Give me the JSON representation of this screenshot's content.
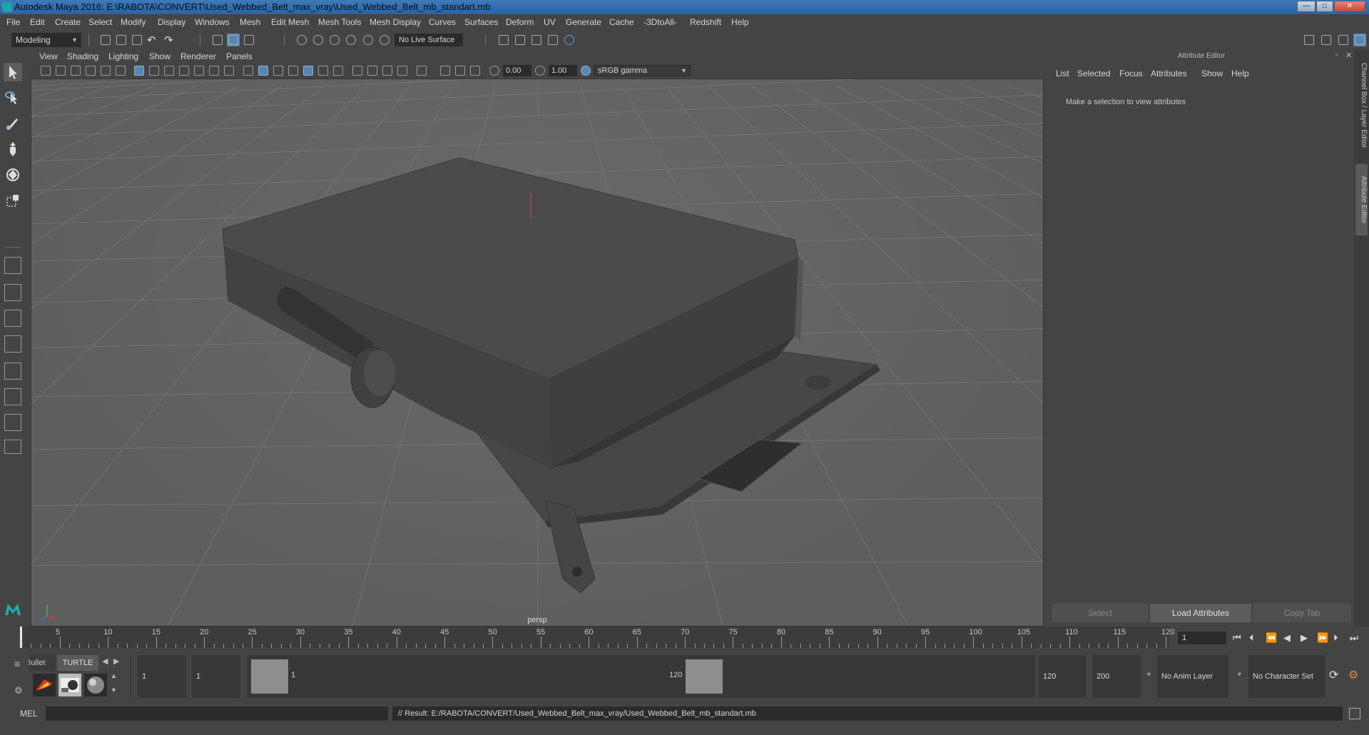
{
  "window": {
    "title": "Autodesk Maya 2016: E:\\RABOTA\\CONVERT\\Used_Webbed_Belt_max_vray\\Used_Webbed_Belt_mb_standart.mb",
    "min_label": "—",
    "max_label": "□",
    "close_label": "✕"
  },
  "menubar": [
    "File",
    "Edit",
    "Create",
    "Select",
    "Modify",
    "Display",
    "Windows",
    "Mesh",
    "Edit Mesh",
    "Mesh Tools",
    "Mesh Display",
    "Curves",
    "Surfaces",
    "Deform",
    "UV",
    "Generate",
    "Cache",
    "-3DtoAll-",
    "Redshift",
    "Help"
  ],
  "statusline": {
    "mode": "Modeling",
    "live_surface": "No Live Surface"
  },
  "viewport": {
    "menu": [
      "View",
      "Shading",
      "Lighting",
      "Show",
      "Renderer",
      "Panels"
    ],
    "exposure": "0.00",
    "gamma": "1.00",
    "color_space": "sRGB gamma",
    "camera": "persp",
    "colors": {
      "background": "#5e5e5e",
      "grid": "#777777",
      "model": "#4a4a4a"
    }
  },
  "attribute_editor": {
    "title": "Attribute Editor",
    "menu": [
      "List",
      "Selected",
      "Focus",
      "Attributes",
      "Show",
      "Help"
    ],
    "message": "Make a selection to view attributes",
    "buttons": {
      "select": "Select",
      "load": "Load Attributes",
      "copy": "Copy Tab"
    },
    "side_tabs": [
      "Channel Box / Layer Editor",
      "Attribute Editor"
    ]
  },
  "timeline": {
    "ticks": [
      "5",
      "10",
      "15",
      "20",
      "25",
      "30",
      "35",
      "40",
      "45",
      "50",
      "55",
      "60",
      "65",
      "70",
      "75",
      "80",
      "85",
      "90",
      "95",
      "100",
      "105",
      "110",
      "115",
      "120"
    ],
    "current_frame": "1",
    "current_frame_field": "1"
  },
  "range": {
    "shelf_tabs": [
      "Bullet",
      "TURTLE"
    ],
    "start": "1",
    "playback_start": "1",
    "range_start_label": "1",
    "range_end_label": "120",
    "playback_end": "120",
    "end": "200",
    "anim_layer": "No Anim Layer",
    "char_set": "No Character Set"
  },
  "command": {
    "lang": "MEL",
    "result": "// Result: E:/RABOTA/CONVERT/Used_Webbed_Belt_max_vray/Used_Webbed_Belt_mb_standart.mb"
  }
}
